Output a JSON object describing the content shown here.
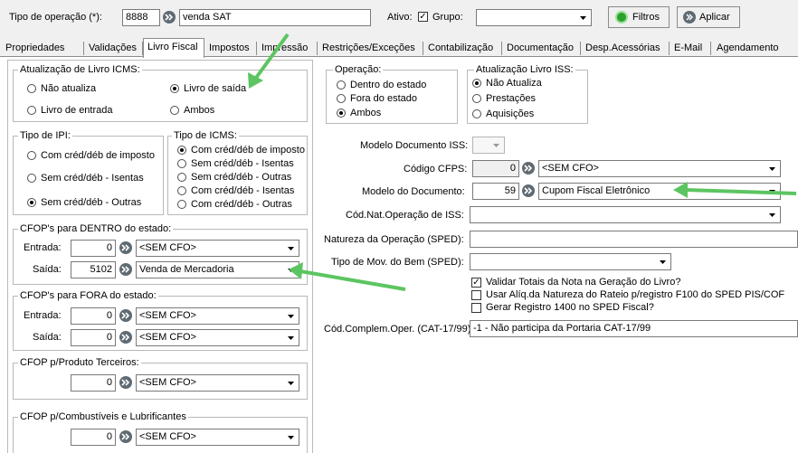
{
  "header": {
    "tipo_label": "Tipo de operação (*):",
    "tipo_code": "8888",
    "tipo_desc": "venda SAT",
    "ativo_label": "Ativo:",
    "grupo_label": "Grupo:",
    "filtros_label": "Filtros",
    "aplicar_label": "Aplicar"
  },
  "tabs": [
    {
      "label": "Propriedades"
    },
    {
      "label": "Validações"
    },
    {
      "label": "Livro Fiscal"
    },
    {
      "label": "Impostos"
    },
    {
      "label": "Impressão"
    },
    {
      "label": "Restrições/Exceções"
    },
    {
      "label": "Contabilização"
    },
    {
      "label": "Documentação"
    },
    {
      "label": "Desp.Acessórias"
    },
    {
      "label": "E-Mail"
    },
    {
      "label": "Agendamento"
    }
  ],
  "livro_icms": {
    "title": "Atualização de Livro ICMS:",
    "opt1": "Não atualiza",
    "opt2": "Livro de saída",
    "opt3": "Livro de entrada",
    "opt4": "Ambos"
  },
  "tipo_ipi": {
    "title": "Tipo de IPI:",
    "opt1": "Com créd/déb de imposto",
    "opt2": "Sem créd/déb - Isentas",
    "opt3": "Sem créd/déb - Outras"
  },
  "tipo_icms": {
    "title": "Tipo de ICMS:",
    "opt1": "Com créd/déb de imposto",
    "opt2": "Sem créd/déb - Isentas",
    "opt3": "Sem créd/déb - Outras",
    "opt4": "Com créd/déb - Isentas",
    "opt5": "Com créd/déb - Outras"
  },
  "cfop_dentro": {
    "title": "CFOP's para DENTRO do estado:",
    "entrada_label": "Entrada:",
    "entrada_code": "0",
    "entrada_desc": "<SEM CFO>",
    "saida_label": "Saída:",
    "saida_code": "5102",
    "saida_desc": "Venda de Mercadoria"
  },
  "cfop_fora": {
    "title": "CFOP's para FORA do estado:",
    "entrada_label": "Entrada:",
    "entrada_code": "0",
    "entrada_desc": "<SEM CFO>",
    "saida_label": "Saída:",
    "saida_code": "0",
    "saida_desc": "<SEM CFO>"
  },
  "cfop_terceiros": {
    "title": "CFOP p/Produto Terceiros:",
    "code": "0",
    "desc": "<SEM CFO>"
  },
  "cfop_combustiveis": {
    "title": "CFOP p/Combustíveis e Lubrificantes",
    "code": "0",
    "desc": "<SEM CFO>"
  },
  "operacao": {
    "title": "Operação:",
    "opt1": "Dentro do estado",
    "opt2": "Fora do estado",
    "opt3": "Ambos"
  },
  "livro_iss": {
    "title": "Atualização Livro ISS:",
    "opt1": "Não Atualiza",
    "opt2": "Prestações",
    "opt3": "Aquisições"
  },
  "fields": {
    "modelo_iss_label": "Modelo Documento ISS:",
    "cfps_label": "Código CFPS:",
    "cfps_code": "0",
    "cfps_desc": "<SEM CFO>",
    "modelo_doc_label": "Modelo do Documento:",
    "modelo_doc_code": "59",
    "modelo_doc_desc": "Cupom Fiscal Eletrônico",
    "cod_nat_label": "Cód.Nat.Operação de ISS:",
    "natureza_label": "Natureza da Operação (SPED):",
    "tipo_mov_label": "Tipo de Mov. do  Bem (SPED):",
    "chk1": "Validar Totais da Nota na Geração do Livro?",
    "chk2": "Usar Alíq.da Natureza do Rateio p/registro F100 do SPED PIS/COF",
    "chk3": "Gerar Registro 1400 no SPED Fiscal?",
    "cat_label": "Cód.Complem.Oper. (CAT-17/99)",
    "cat_value": "-1 - Não participa da Portaria CAT-17/99"
  },
  "colors": {
    "arrow": "#5cc561",
    "tab_bg": "#f0f0f0",
    "icon_gray": "#5f6b73",
    "filtros_green": "#2aa12a"
  }
}
